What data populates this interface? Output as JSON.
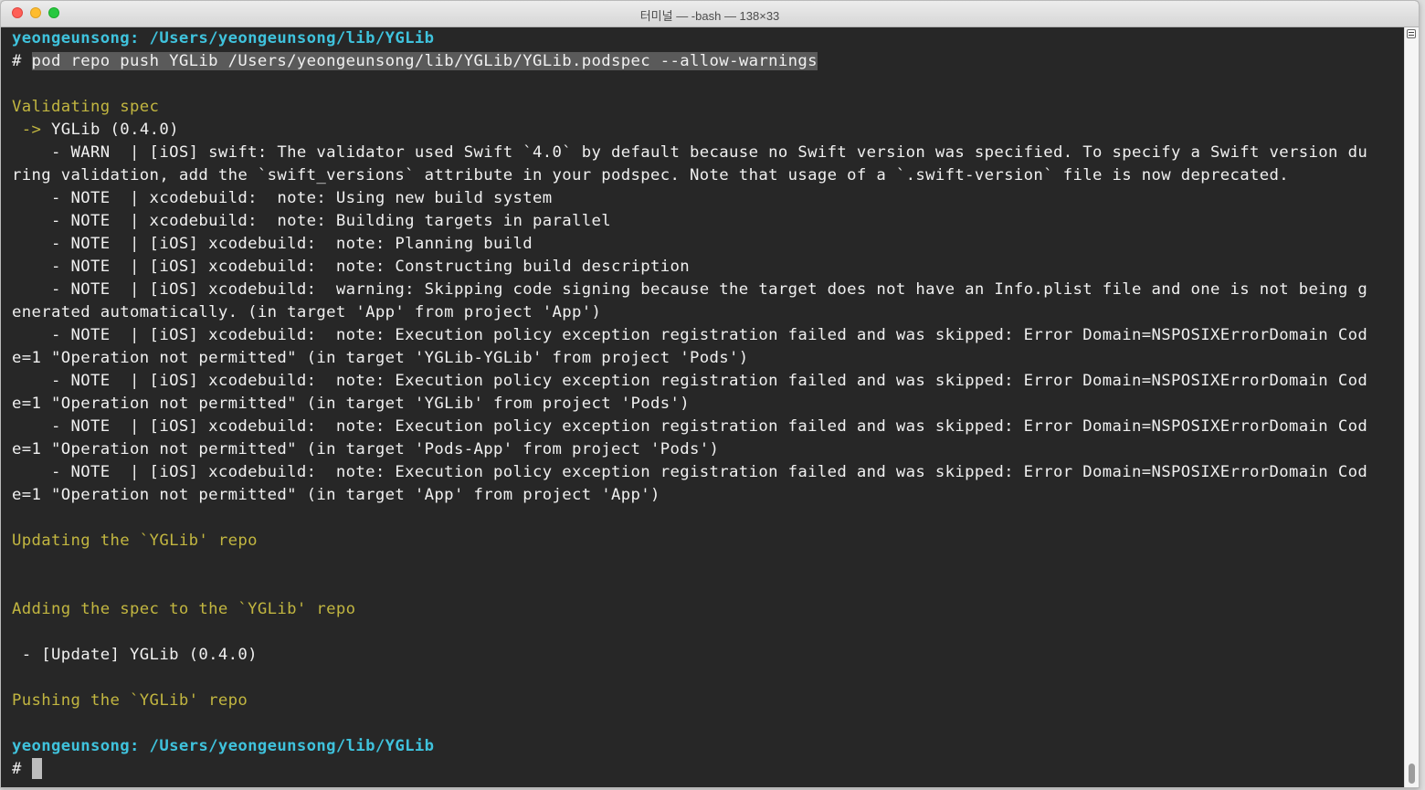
{
  "window": {
    "title": "터미널 — -bash — 138×33"
  },
  "terminal": {
    "lines": [
      {
        "parts": [
          {
            "text": "yeongeunsong: /Users/yeongeunsong/lib/YGLib",
            "cls": "prompt-user"
          }
        ]
      },
      {
        "parts": [
          {
            "text": "# "
          },
          {
            "text": "pod repo push YGLib /Users/yeongeunsong/lib/YGLib/YGLib.podspec --allow-warnings",
            "cls": "cmd"
          }
        ]
      },
      {
        "parts": [
          {
            "text": ""
          }
        ]
      },
      {
        "parts": [
          {
            "text": "Validating spec",
            "cls": "yellow"
          }
        ]
      },
      {
        "parts": [
          {
            "text": " -> ",
            "cls": "yellow"
          },
          {
            "text": "YGLib (0.4.0)"
          }
        ]
      },
      {
        "parts": [
          {
            "text": "    - WARN  | [iOS] swift: The validator used Swift `4.0` by default because no Swift version was specified. To specify a Swift version du"
          }
        ]
      },
      {
        "parts": [
          {
            "text": "ring validation, add the `swift_versions` attribute in your podspec. Note that usage of a `.swift-version` file is now deprecated."
          }
        ]
      },
      {
        "parts": [
          {
            "text": "    - NOTE  | xcodebuild:  note: Using new build system"
          }
        ]
      },
      {
        "parts": [
          {
            "text": "    - NOTE  | xcodebuild:  note: Building targets in parallel"
          }
        ]
      },
      {
        "parts": [
          {
            "text": "    - NOTE  | [iOS] xcodebuild:  note: Planning build"
          }
        ]
      },
      {
        "parts": [
          {
            "text": "    - NOTE  | [iOS] xcodebuild:  note: Constructing build description"
          }
        ]
      },
      {
        "parts": [
          {
            "text": "    - NOTE  | [iOS] xcodebuild:  warning: Skipping code signing because the target does not have an Info.plist file and one is not being g"
          }
        ]
      },
      {
        "parts": [
          {
            "text": "enerated automatically. (in target 'App' from project 'App')"
          }
        ]
      },
      {
        "parts": [
          {
            "text": "    - NOTE  | [iOS] xcodebuild:  note: Execution policy exception registration failed and was skipped: Error Domain=NSPOSIXErrorDomain Cod"
          }
        ]
      },
      {
        "parts": [
          {
            "text": "e=1 \"Operation not permitted\" (in target 'YGLib-YGLib' from project 'Pods')"
          }
        ]
      },
      {
        "parts": [
          {
            "text": "    - NOTE  | [iOS] xcodebuild:  note: Execution policy exception registration failed and was skipped: Error Domain=NSPOSIXErrorDomain Cod"
          }
        ]
      },
      {
        "parts": [
          {
            "text": "e=1 \"Operation not permitted\" (in target 'YGLib' from project 'Pods')"
          }
        ]
      },
      {
        "parts": [
          {
            "text": "    - NOTE  | [iOS] xcodebuild:  note: Execution policy exception registration failed and was skipped: Error Domain=NSPOSIXErrorDomain Cod"
          }
        ]
      },
      {
        "parts": [
          {
            "text": "e=1 \"Operation not permitted\" (in target 'Pods-App' from project 'Pods')"
          }
        ]
      },
      {
        "parts": [
          {
            "text": "    - NOTE  | [iOS] xcodebuild:  note: Execution policy exception registration failed and was skipped: Error Domain=NSPOSIXErrorDomain Cod"
          }
        ]
      },
      {
        "parts": [
          {
            "text": "e=1 \"Operation not permitted\" (in target 'App' from project 'App')"
          }
        ]
      },
      {
        "parts": [
          {
            "text": ""
          }
        ]
      },
      {
        "parts": [
          {
            "text": "Updating the `YGLib' repo",
            "cls": "yellow"
          }
        ]
      },
      {
        "parts": [
          {
            "text": ""
          }
        ]
      },
      {
        "parts": [
          {
            "text": ""
          }
        ]
      },
      {
        "parts": [
          {
            "text": "Adding the spec to the `YGLib' repo",
            "cls": "yellow"
          }
        ]
      },
      {
        "parts": [
          {
            "text": ""
          }
        ]
      },
      {
        "parts": [
          {
            "text": " - [Update] YGLib (0.4.0)"
          }
        ]
      },
      {
        "parts": [
          {
            "text": ""
          }
        ]
      },
      {
        "parts": [
          {
            "text": "Pushing the `YGLib' repo",
            "cls": "yellow"
          }
        ]
      },
      {
        "parts": [
          {
            "text": ""
          }
        ]
      },
      {
        "parts": [
          {
            "text": "yeongeunsong: /Users/yeongeunsong/lib/YGLib",
            "cls": "prompt-user"
          }
        ]
      },
      {
        "parts": [
          {
            "text": "# "
          }
        ],
        "cursor": true
      }
    ]
  },
  "colors": {
    "background": "#272727",
    "text": "#f0f0f0",
    "prompt": "#3fc2dc",
    "heading": "#c2b640",
    "selection": "#5a5a5a"
  }
}
